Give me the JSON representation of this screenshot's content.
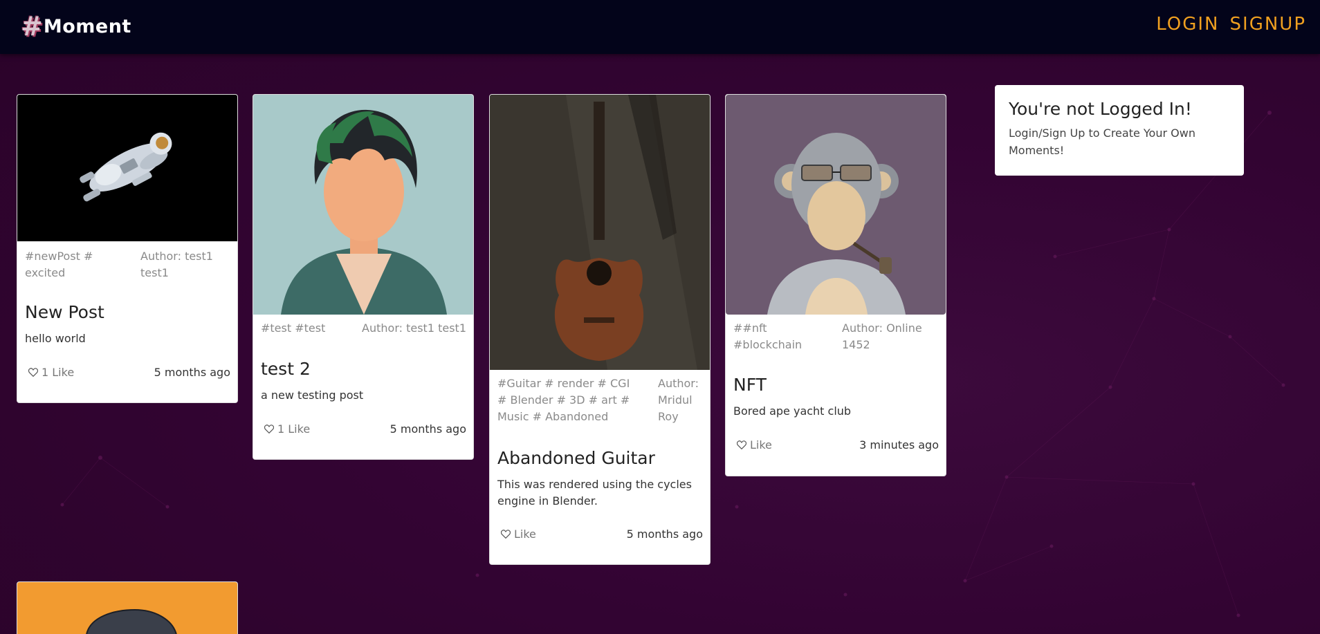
{
  "navbar": {
    "brand_hash": "#",
    "brand_name": "Moment",
    "login_label": "LOGIN",
    "signup_label": "SIGNUP"
  },
  "posts": [
    {
      "image": "astronaut floating in space",
      "tags": "#newPost # excited",
      "author": "Author: test1 test1",
      "title": "New Post",
      "description": "hello world",
      "likes": "1 Like",
      "ago": "5 months ago"
    },
    {
      "image": "anime boy in green hoodie",
      "tags": "#test #test",
      "author": "Author: test1 test1",
      "title": "test 2",
      "description": "a new testing post",
      "likes": "1 Like",
      "ago": "5 months ago"
    },
    {
      "image": "acoustic guitar against wall",
      "tags": "#Guitar # render # CGI # Blender # 3D # art # Music # Abandoned",
      "author": "Author: Mridul Roy",
      "title": "Abandoned Guitar",
      "description": "This was rendered using the cycles engine in Blender.",
      "likes": "Like",
      "ago": "5 months ago"
    },
    {
      "image": "bored ape with pipe",
      "tags": "##nft #blockchain",
      "author": "Author: Online 1452",
      "title": "NFT",
      "description": "Bored ape yacht club",
      "likes": "Like",
      "ago": "3 minutes ago"
    },
    {
      "image": "orange background with dark hat"
    }
  ],
  "notice": {
    "title": "You're not Logged In!",
    "message": "Login/Sign Up to Create Your Own Moments!"
  },
  "colors": {
    "navbar_bg": "#03041a",
    "page_bg": "#330433",
    "nav_link": "#f0a020"
  },
  "icons": {
    "like": "heart-outline-icon"
  }
}
